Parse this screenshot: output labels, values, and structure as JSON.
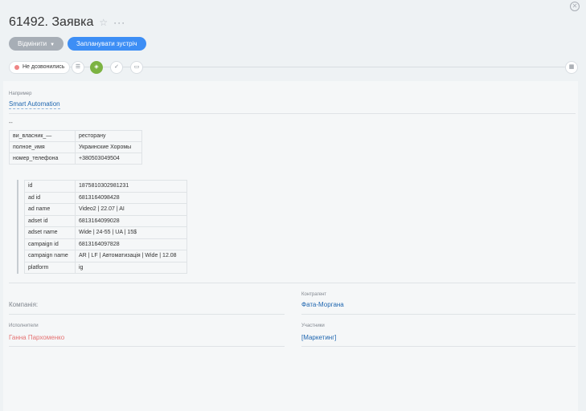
{
  "header": {
    "title": "61492. Заявка",
    "star_icon": "☆",
    "more_icon": "···",
    "close_icon": "✕"
  },
  "actions": {
    "cancel_label": "Відмінити",
    "schedule_label": "Запланувати зустріч"
  },
  "toolbar": {
    "stage_label": "Не дозвонились",
    "stage_color": "#ef8585",
    "icons": [
      "list-icon",
      "flag-icon",
      "check-circle-icon",
      "comment-icon",
      "calendar-icon"
    ]
  },
  "fields": {
    "example_label": "Например",
    "example_value": "Smart Automation",
    "dash_text": "--",
    "form_rows": [
      [
        "ви_власник_—",
        "ресторану"
      ],
      [
        "полное_имя",
        "Украинские Хоромы"
      ],
      [
        "номер_телефона",
        "+380503049504"
      ]
    ],
    "ad_rows": [
      [
        "id",
        "1875810302981231"
      ],
      [
        "ad id",
        "6813164098428"
      ],
      [
        "ad name",
        "Video2 | 22.07 | AI"
      ],
      [
        "adset id",
        "6813164099028"
      ],
      [
        "adset name",
        "Wide | 24-55 | UA | 15$"
      ],
      [
        "campaign id",
        "6813164097828"
      ],
      [
        "campaign name",
        "AR | LF | Автоматизація | Wide | 12.08"
      ],
      [
        "platform",
        "ig"
      ]
    ],
    "company_label": "Компанія:",
    "contractor_label": "Контрагент",
    "contractor_value": "Фата-Моргана",
    "executors_label": "Исполнители",
    "executors_value": "Ганна Пархоменко",
    "participants_label": "Участники",
    "participants_value": "[Маркетинг]"
  }
}
